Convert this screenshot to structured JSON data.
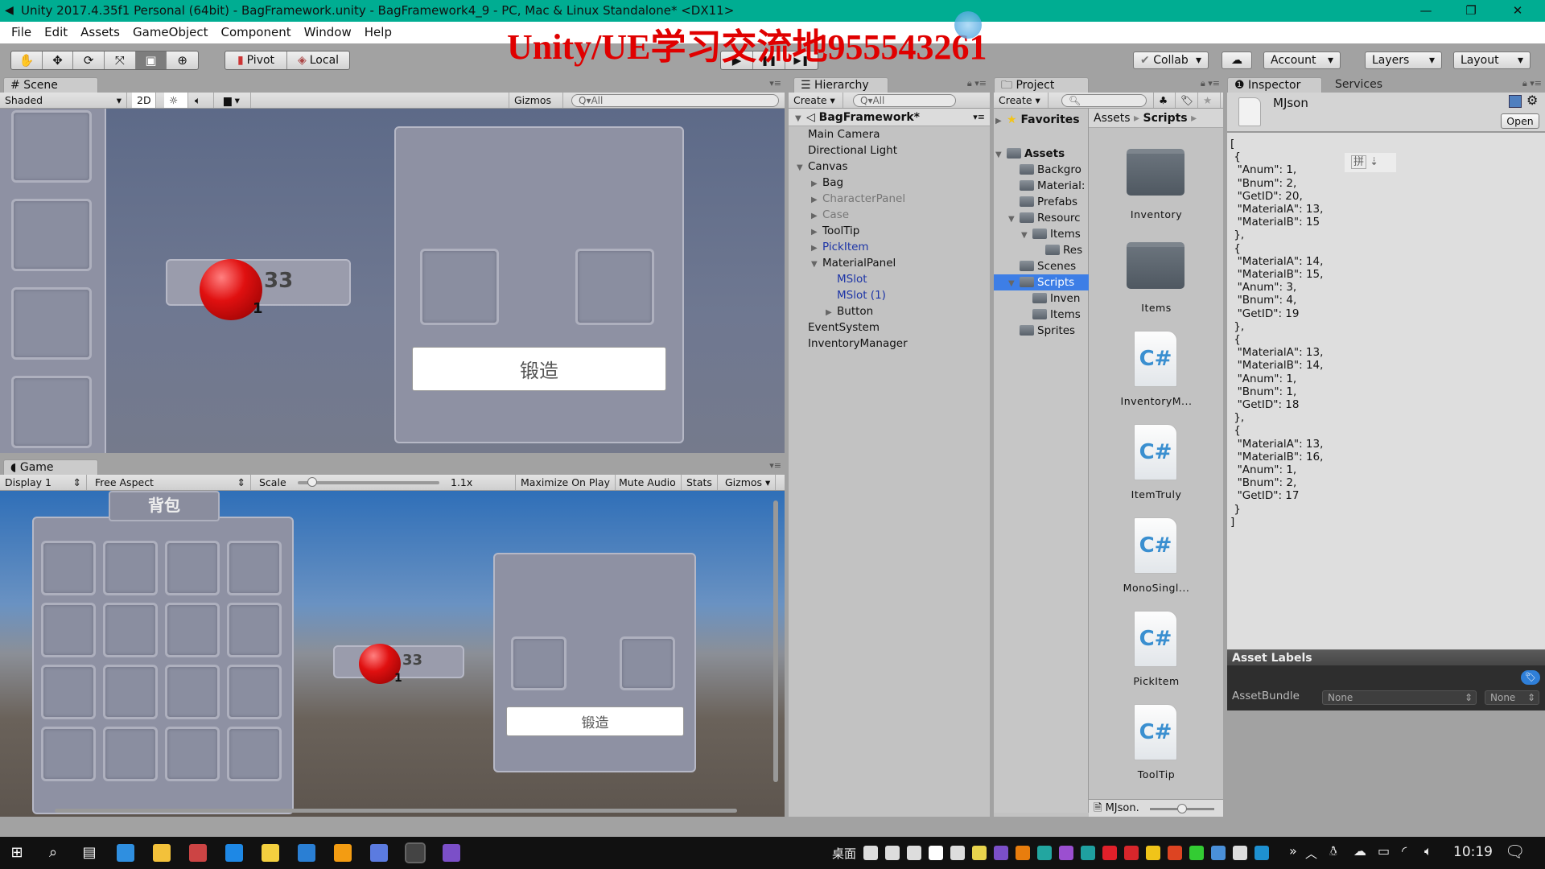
{
  "window": {
    "title": "Unity 2017.4.35f1 Personal (64bit) - BagFramework.unity - BagFramework4_9 - PC, Mac & Linux Standalone* <DX11>",
    "controls": [
      "minimize",
      "restore",
      "close"
    ]
  },
  "watermark": "Unity/UE学习交流地955543261",
  "menu": [
    "File",
    "Edit",
    "Assets",
    "GameObject",
    "Component",
    "Window",
    "Help"
  ],
  "toolbar": {
    "tools": [
      "hand-tool",
      "move-tool",
      "rotate-tool",
      "scale-tool",
      "rect-tool",
      "transform-tool"
    ],
    "active_tool": "rect-tool",
    "pivot": "Pivot",
    "local": "Local",
    "play": "▶",
    "pause": "❚❚",
    "step": "▶❚",
    "collab": "Collab",
    "account": "Account",
    "layers": "Layers",
    "layout": "Layout"
  },
  "scene": {
    "tab": "Scene",
    "shading": "Shaded",
    "mode_2d": "2D",
    "gizmos": "Gizmos",
    "search_placeholder": "All",
    "item_count": "33",
    "item_sub": "1",
    "forge_button": "锻造"
  },
  "game": {
    "tab": "Game",
    "display": "Display 1",
    "aspect": "Free Aspect",
    "scale_label": "Scale",
    "scale_value": "1.1x",
    "scale_fraction": 0.1,
    "buttons": [
      "Maximize On Play",
      "Mute Audio",
      "Stats",
      "Gizmos"
    ],
    "bag_title": "背包",
    "item_count": "33",
    "item_sub": "1",
    "forge_button": "锻造"
  },
  "hierarchy": {
    "tab": "Hierarchy",
    "create": "Create",
    "search_placeholder": "All",
    "scene_name": "BagFramework*",
    "items": [
      {
        "label": "Main Camera",
        "depth": 0,
        "arrow": "",
        "style": ""
      },
      {
        "label": "Directional Light",
        "depth": 0,
        "arrow": "",
        "style": ""
      },
      {
        "label": "Canvas",
        "depth": 0,
        "arrow": "▼",
        "style": ""
      },
      {
        "label": "Bag",
        "depth": 1,
        "arrow": "▶",
        "style": ""
      },
      {
        "label": "CharacterPanel",
        "depth": 1,
        "arrow": "▶",
        "style": "grey"
      },
      {
        "label": "Case",
        "depth": 1,
        "arrow": "▶",
        "style": "grey"
      },
      {
        "label": "ToolTip",
        "depth": 1,
        "arrow": "▶",
        "style": ""
      },
      {
        "label": "PickItem",
        "depth": 1,
        "arrow": "▶",
        "style": "blue"
      },
      {
        "label": "MaterialPanel",
        "depth": 1,
        "arrow": "▼",
        "style": ""
      },
      {
        "label": "MSlot",
        "depth": 2,
        "arrow": "",
        "style": "blue"
      },
      {
        "label": "MSlot (1)",
        "depth": 2,
        "arrow": "",
        "style": "blue"
      },
      {
        "label": "Button",
        "depth": 2,
        "arrow": "▶",
        "style": ""
      },
      {
        "label": "EventSystem",
        "depth": 0,
        "arrow": "",
        "style": ""
      },
      {
        "label": "InventoryManager",
        "depth": 0,
        "arrow": "",
        "style": ""
      }
    ]
  },
  "project": {
    "tab": "Project",
    "create": "Create",
    "favorites": "Favorites",
    "breadcrumb": [
      "Assets",
      "Scripts"
    ],
    "tree": [
      {
        "label": "Assets",
        "depth": 0,
        "arrow": "▼",
        "selected": false
      },
      {
        "label": "Backgro",
        "depth": 1,
        "arrow": "",
        "selected": false
      },
      {
        "label": "Material:",
        "depth": 1,
        "arrow": "",
        "selected": false
      },
      {
        "label": "Prefabs",
        "depth": 1,
        "arrow": "",
        "selected": false
      },
      {
        "label": "Resourc",
        "depth": 1,
        "arrow": "▼",
        "selected": false
      },
      {
        "label": "Items",
        "depth": 2,
        "arrow": "▼",
        "selected": false
      },
      {
        "label": "Res",
        "depth": 3,
        "arrow": "",
        "selected": false
      },
      {
        "label": "Scenes",
        "depth": 1,
        "arrow": "",
        "selected": false
      },
      {
        "label": "Scripts",
        "depth": 1,
        "arrow": "▼",
        "selected": true
      },
      {
        "label": "Inven",
        "depth": 2,
        "arrow": "",
        "selected": false
      },
      {
        "label": "Items",
        "depth": 2,
        "arrow": "",
        "selected": false
      },
      {
        "label": "Sprites",
        "depth": 1,
        "arrow": "",
        "selected": false
      }
    ],
    "assets": [
      {
        "label": "Inventory",
        "type": "folder"
      },
      {
        "label": "Items",
        "type": "folder"
      },
      {
        "label": "InventoryM...",
        "type": "cs"
      },
      {
        "label": "ItemTruly",
        "type": "cs"
      },
      {
        "label": "MonoSingl...",
        "type": "cs"
      },
      {
        "label": "PickItem",
        "type": "cs"
      },
      {
        "label": "ToolTip",
        "type": "cs"
      }
    ],
    "footer_file": "MJson.",
    "icon_size_fraction": 0.5
  },
  "inspector": {
    "tab": "Inspector",
    "tab2": "Services",
    "asset_name": "MJson",
    "open": "Open",
    "ime_label": "拼",
    "content": "[\n {\n  \"Anum\": 1,\n  \"Bnum\": 2,\n  \"GetID\": 20,\n  \"MaterialA\": 13,\n  \"MaterialB\": 15\n },\n {\n  \"MaterialA\": 14,\n  \"MaterialB\": 15,\n  \"Anum\": 3,\n  \"Bnum\": 4,\n  \"GetID\": 19\n },\n {\n  \"MaterialA\": 13,\n  \"MaterialB\": 14,\n  \"Anum\": 1,\n  \"Bnum\": 1,\n  \"GetID\": 18\n },\n {\n  \"MaterialA\": 13,\n  \"MaterialB\": 16,\n  \"Anum\": 1,\n  \"Bnum\": 2,\n  \"GetID\": 17\n }\n]",
    "asset_labels": "Asset Labels",
    "assetbundle_label": "AssetBundle",
    "bundle_name": "None",
    "bundle_variant": "None"
  },
  "taskbar": {
    "desktop_label": "桌面",
    "clock": "10:19",
    "pinned": [
      "start",
      "search",
      "task-view",
      "edge",
      "file-explorer",
      "app",
      "app",
      "sticky-notes",
      "app",
      "app",
      "app",
      "unity",
      "visual-studio"
    ],
    "tray_colors": [
      "#ddd",
      "#ddd",
      "#ddd",
      "#fff",
      "#ddd",
      "#e8d44d",
      "#7b4fc8",
      "#e87d0d",
      "#22a6a0",
      "#9b4fd0",
      "#1fa0a0",
      "#e0202a",
      "#d8262b",
      "#f0c419",
      "#d42",
      "#3c3",
      "#4a90d9",
      "#ddd",
      "#1e90d0"
    ]
  }
}
